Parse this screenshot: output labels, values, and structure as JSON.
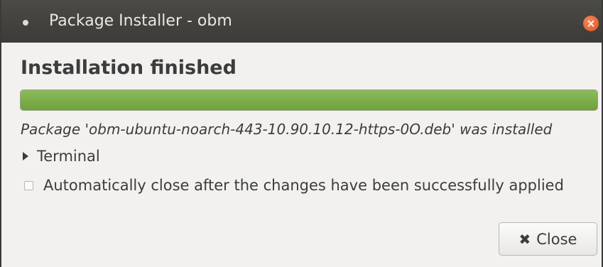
{
  "window": {
    "title": "Package Installer - obm",
    "close_glyph": "×"
  },
  "main": {
    "heading": "Installation finished",
    "progress": {
      "percent": 100,
      "color": "#7aab48"
    },
    "status_message": "Package 'obm-ubuntu-noarch-443-10.90.10.12-https-0O.deb' was installed",
    "terminal_expander": {
      "label": "Terminal",
      "expanded": false
    },
    "auto_close": {
      "label": "Automatically close after the changes have been successfully applied",
      "checked": false
    }
  },
  "footer": {
    "close_button": {
      "icon": "close-icon",
      "icon_glyph": "✖",
      "label": "Close"
    }
  }
}
